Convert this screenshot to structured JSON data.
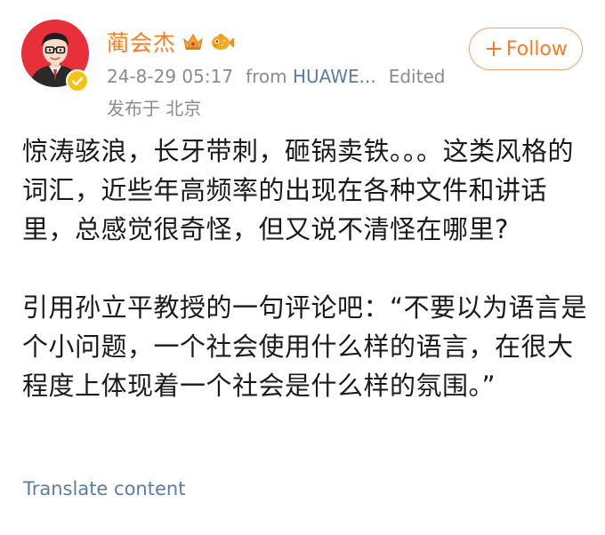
{
  "post": {
    "author_name": "蔺会杰",
    "follow_label": "Follow",
    "follow_icon": "+",
    "timestamp": "24-8-29 05:17",
    "from_label": "from",
    "source": "HUAWE...",
    "edited_label": "Edited",
    "location": "发布于 北京",
    "paragraphs": [
      "惊涛骇浪，长牙带刺，砸锅卖铁。。。这类风格的词汇，近些年高频率的出现在各种文件和讲话里，总感觉很奇怪，但又说不清怪在哪里?",
      "引用孙立平教授的一句评论吧：“不要以为语言是个小问题，一个社会使用什么样的语言，在很大程度上体现着一个社会是什么样的氛围。”"
    ],
    "translate_label": "Translate content"
  },
  "icons": {
    "avatar": "avatar-portrait",
    "verified": "verified-badge-icon",
    "crown": "crown-badge-icon",
    "fish": "fish-badge-icon"
  },
  "colors": {
    "username": "#f57d25",
    "link": "#5a7ca8",
    "meta": "#8b8b8b",
    "follow_border": "#f0a366",
    "avatar_bg": "#e8303a",
    "verified": "#f2c414"
  }
}
